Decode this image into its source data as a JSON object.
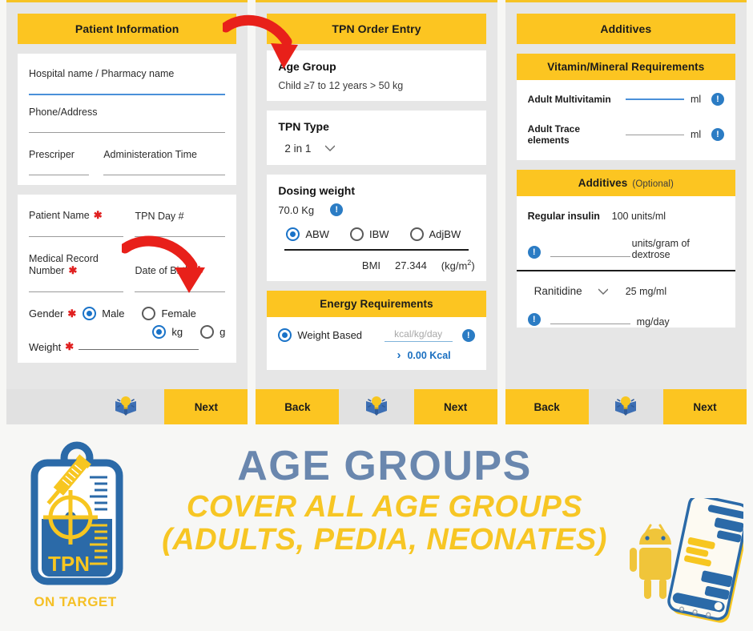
{
  "colors": {
    "yellow": "#fcc521",
    "blue": "#2b7cc4",
    "red_arrow": "#e8201a",
    "banner_blue": "#6a87ae",
    "banner_yellow": "#f7c624",
    "screen_bg": "#e6e6e6"
  },
  "screen1": {
    "title": "Patient Information",
    "fields": {
      "hospital": "Hospital name / Pharmacy name",
      "phone_address": "Phone/Address",
      "prescriber": "Prescriper",
      "admin_time": "Administeration Time",
      "patient_name": "Patient Name",
      "tpn_day": "TPN Day #",
      "mrn": "Medical Record Number",
      "dob": "Date of Birth",
      "gender": "Gender",
      "weight": "Weight"
    },
    "gender_options": [
      {
        "label": "Male",
        "selected": true
      },
      {
        "label": "Female",
        "selected": false
      }
    ],
    "weight_units": [
      {
        "label": "kg",
        "selected": true
      },
      {
        "label": "g",
        "selected": false
      }
    ],
    "required_mark": "✱",
    "nav": {
      "next": "Next",
      "tips_icon": "lightbulb-book-icon"
    }
  },
  "screen2": {
    "title": "TPN Order Entry",
    "age_group": {
      "label": "Age Group",
      "value": "Child ≥7 to 12 years > 50 kg"
    },
    "tpn_type": {
      "label": "TPN Type",
      "value": "2 in 1"
    },
    "dosing_weight": {
      "label": "Dosing weight",
      "value": "70.0 Kg",
      "options": [
        {
          "label": "ABW",
          "selected": true
        },
        {
          "label": "IBW",
          "selected": false
        },
        {
          "label": "AdjBW",
          "selected": false
        }
      ],
      "bmi_label": "BMI",
      "bmi_value": "27.344",
      "bmi_unit_prefix": "(kg/m",
      "bmi_unit_exp": "2",
      "bmi_unit_suffix": ")"
    },
    "energy": {
      "title": "Energy Requirements",
      "option_label": "Weight Based",
      "input_placeholder": "kcal/kg/day",
      "result": "0.00 Kcal",
      "chevron": "›"
    },
    "nav": {
      "back": "Back",
      "next": "Next",
      "tips_icon": "lightbulb-book-icon"
    }
  },
  "screen3": {
    "title": "Additives",
    "vitamin_section": {
      "title": "Vitamin/Mineral Requirements",
      "rows": [
        {
          "label": "Adult Multivitamin",
          "unit": "ml",
          "focused": true
        },
        {
          "label": "Adult Trace elements",
          "unit": "ml",
          "focused": false
        }
      ]
    },
    "additives_section": {
      "title": "Additives",
      "optional": "(Optional)",
      "insulin": {
        "name": "Regular insulin",
        "concentration": "100 units/ml",
        "unit": "units/gram of dextrose"
      },
      "ranitidine": {
        "name": "Ranitidine",
        "concentration": "25 mg/ml",
        "unit": "mg/day"
      }
    },
    "nav": {
      "back": "Back",
      "next": "Next",
      "tips_icon": "lightbulb-book-icon"
    }
  },
  "banner": {
    "logo_text": "TPN",
    "logo_caption": "ON TARGET",
    "headline_1": "AGE GROUPS",
    "headline_2": "COVER ALL AGE GROUPS",
    "headline_3": "(ADULTS, PEDIA, NEONATES)"
  }
}
